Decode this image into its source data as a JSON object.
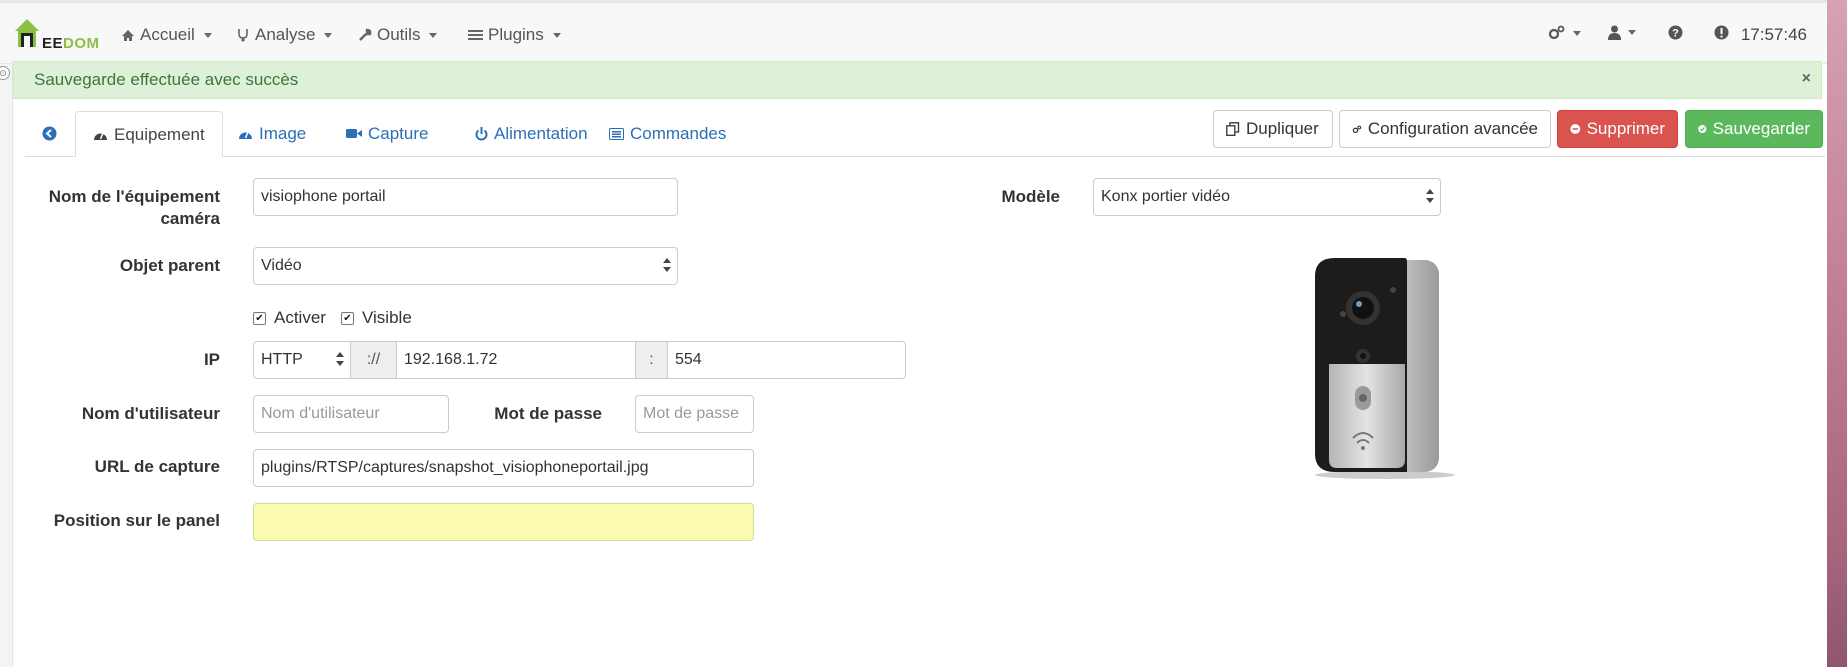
{
  "navbar": {
    "logo_text_prefix": "EE",
    "logo_text_suffix": "DOM",
    "menu": [
      {
        "label": "Accueil",
        "icon": "home-icon"
      },
      {
        "label": "Analyse",
        "icon": "stethoscope-icon"
      },
      {
        "label": "Outils",
        "icon": "wrench-icon"
      },
      {
        "label": "Plugins",
        "icon": "list-icon"
      }
    ],
    "right_icons": [
      "gears-icon",
      "user-icon",
      "help-icon",
      "alert-icon"
    ],
    "time": "17:57:46"
  },
  "alert": {
    "message": "Sauvegarde effectuée avec succès",
    "close": "×"
  },
  "tabs": [
    {
      "label": "",
      "icon": "back-arrow-icon"
    },
    {
      "label": "Equipement",
      "icon": "tachometer-icon",
      "active": true
    },
    {
      "label": "Image",
      "icon": "tachometer-icon"
    },
    {
      "label": "Capture",
      "icon": "video-icon"
    },
    {
      "label": "Alimentation",
      "icon": "power-icon"
    },
    {
      "label": "Commandes",
      "icon": "list-alt-icon"
    }
  ],
  "actions": {
    "duplicate": "Dupliquer",
    "advanced_config": "Configuration avancée",
    "delete": "Supprimer",
    "save": "Sauvegarder"
  },
  "form": {
    "name_label_line1": "Nom de l'équipement",
    "name_label_line2": "caméra",
    "name_value": "visiophone portail",
    "parent_label": "Objet parent",
    "parent_value": "Vidéo",
    "activate_label": "Activer",
    "visible_label": "Visible",
    "ip_label": "IP",
    "protocol_value": "HTTP",
    "scheme_sep": "://",
    "ip_value": "192.168.1.72",
    "port_sep": ":",
    "port_value": "554",
    "username_label": "Nom d'utilisateur",
    "username_placeholder": "Nom d'utilisateur",
    "password_label": "Mot de passe",
    "password_placeholder": "Mot de passe",
    "capture_url_label": "URL de capture",
    "capture_url_value": "plugins/RTSP/captures/snapshot_visiophoneportail.jpg",
    "panel_position_label": "Position sur le panel",
    "panel_position_value": "",
    "model_label": "Modèle",
    "model_value": "Konx portier vidéo"
  }
}
